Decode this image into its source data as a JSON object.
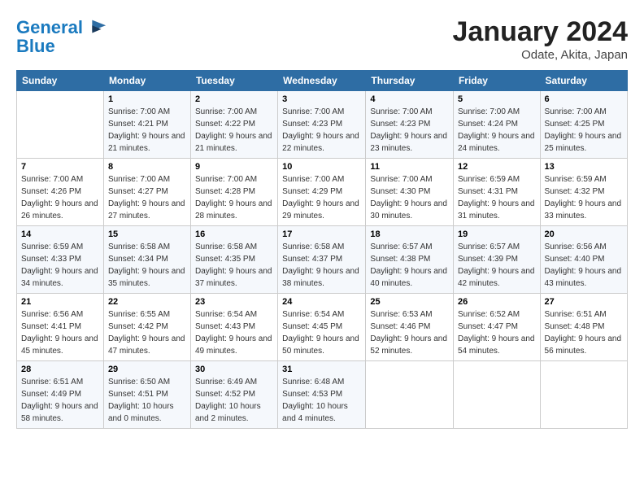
{
  "header": {
    "logo_line1": "General",
    "logo_line2": "Blue",
    "month_title": "January 2024",
    "location": "Odate, Akita, Japan"
  },
  "weekdays": [
    "Sunday",
    "Monday",
    "Tuesday",
    "Wednesday",
    "Thursday",
    "Friday",
    "Saturday"
  ],
  "weeks": [
    [
      {
        "day": "",
        "sunrise": "",
        "sunset": "",
        "daylight": ""
      },
      {
        "day": "1",
        "sunrise": "Sunrise: 7:00 AM",
        "sunset": "Sunset: 4:21 PM",
        "daylight": "Daylight: 9 hours and 21 minutes."
      },
      {
        "day": "2",
        "sunrise": "Sunrise: 7:00 AM",
        "sunset": "Sunset: 4:22 PM",
        "daylight": "Daylight: 9 hours and 21 minutes."
      },
      {
        "day": "3",
        "sunrise": "Sunrise: 7:00 AM",
        "sunset": "Sunset: 4:23 PM",
        "daylight": "Daylight: 9 hours and 22 minutes."
      },
      {
        "day": "4",
        "sunrise": "Sunrise: 7:00 AM",
        "sunset": "Sunset: 4:23 PM",
        "daylight": "Daylight: 9 hours and 23 minutes."
      },
      {
        "day": "5",
        "sunrise": "Sunrise: 7:00 AM",
        "sunset": "Sunset: 4:24 PM",
        "daylight": "Daylight: 9 hours and 24 minutes."
      },
      {
        "day": "6",
        "sunrise": "Sunrise: 7:00 AM",
        "sunset": "Sunset: 4:25 PM",
        "daylight": "Daylight: 9 hours and 25 minutes."
      }
    ],
    [
      {
        "day": "7",
        "sunrise": "Sunrise: 7:00 AM",
        "sunset": "Sunset: 4:26 PM",
        "daylight": "Daylight: 9 hours and 26 minutes."
      },
      {
        "day": "8",
        "sunrise": "Sunrise: 7:00 AM",
        "sunset": "Sunset: 4:27 PM",
        "daylight": "Daylight: 9 hours and 27 minutes."
      },
      {
        "day": "9",
        "sunrise": "Sunrise: 7:00 AM",
        "sunset": "Sunset: 4:28 PM",
        "daylight": "Daylight: 9 hours and 28 minutes."
      },
      {
        "day": "10",
        "sunrise": "Sunrise: 7:00 AM",
        "sunset": "Sunset: 4:29 PM",
        "daylight": "Daylight: 9 hours and 29 minutes."
      },
      {
        "day": "11",
        "sunrise": "Sunrise: 7:00 AM",
        "sunset": "Sunset: 4:30 PM",
        "daylight": "Daylight: 9 hours and 30 minutes."
      },
      {
        "day": "12",
        "sunrise": "Sunrise: 6:59 AM",
        "sunset": "Sunset: 4:31 PM",
        "daylight": "Daylight: 9 hours and 31 minutes."
      },
      {
        "day": "13",
        "sunrise": "Sunrise: 6:59 AM",
        "sunset": "Sunset: 4:32 PM",
        "daylight": "Daylight: 9 hours and 33 minutes."
      }
    ],
    [
      {
        "day": "14",
        "sunrise": "Sunrise: 6:59 AM",
        "sunset": "Sunset: 4:33 PM",
        "daylight": "Daylight: 9 hours and 34 minutes."
      },
      {
        "day": "15",
        "sunrise": "Sunrise: 6:58 AM",
        "sunset": "Sunset: 4:34 PM",
        "daylight": "Daylight: 9 hours and 35 minutes."
      },
      {
        "day": "16",
        "sunrise": "Sunrise: 6:58 AM",
        "sunset": "Sunset: 4:35 PM",
        "daylight": "Daylight: 9 hours and 37 minutes."
      },
      {
        "day": "17",
        "sunrise": "Sunrise: 6:58 AM",
        "sunset": "Sunset: 4:37 PM",
        "daylight": "Daylight: 9 hours and 38 minutes."
      },
      {
        "day": "18",
        "sunrise": "Sunrise: 6:57 AM",
        "sunset": "Sunset: 4:38 PM",
        "daylight": "Daylight: 9 hours and 40 minutes."
      },
      {
        "day": "19",
        "sunrise": "Sunrise: 6:57 AM",
        "sunset": "Sunset: 4:39 PM",
        "daylight": "Daylight: 9 hours and 42 minutes."
      },
      {
        "day": "20",
        "sunrise": "Sunrise: 6:56 AM",
        "sunset": "Sunset: 4:40 PM",
        "daylight": "Daylight: 9 hours and 43 minutes."
      }
    ],
    [
      {
        "day": "21",
        "sunrise": "Sunrise: 6:56 AM",
        "sunset": "Sunset: 4:41 PM",
        "daylight": "Daylight: 9 hours and 45 minutes."
      },
      {
        "day": "22",
        "sunrise": "Sunrise: 6:55 AM",
        "sunset": "Sunset: 4:42 PM",
        "daylight": "Daylight: 9 hours and 47 minutes."
      },
      {
        "day": "23",
        "sunrise": "Sunrise: 6:54 AM",
        "sunset": "Sunset: 4:43 PM",
        "daylight": "Daylight: 9 hours and 49 minutes."
      },
      {
        "day": "24",
        "sunrise": "Sunrise: 6:54 AM",
        "sunset": "Sunset: 4:45 PM",
        "daylight": "Daylight: 9 hours and 50 minutes."
      },
      {
        "day": "25",
        "sunrise": "Sunrise: 6:53 AM",
        "sunset": "Sunset: 4:46 PM",
        "daylight": "Daylight: 9 hours and 52 minutes."
      },
      {
        "day": "26",
        "sunrise": "Sunrise: 6:52 AM",
        "sunset": "Sunset: 4:47 PM",
        "daylight": "Daylight: 9 hours and 54 minutes."
      },
      {
        "day": "27",
        "sunrise": "Sunrise: 6:51 AM",
        "sunset": "Sunset: 4:48 PM",
        "daylight": "Daylight: 9 hours and 56 minutes."
      }
    ],
    [
      {
        "day": "28",
        "sunrise": "Sunrise: 6:51 AM",
        "sunset": "Sunset: 4:49 PM",
        "daylight": "Daylight: 9 hours and 58 minutes."
      },
      {
        "day": "29",
        "sunrise": "Sunrise: 6:50 AM",
        "sunset": "Sunset: 4:51 PM",
        "daylight": "Daylight: 10 hours and 0 minutes."
      },
      {
        "day": "30",
        "sunrise": "Sunrise: 6:49 AM",
        "sunset": "Sunset: 4:52 PM",
        "daylight": "Daylight: 10 hours and 2 minutes."
      },
      {
        "day": "31",
        "sunrise": "Sunrise: 6:48 AM",
        "sunset": "Sunset: 4:53 PM",
        "daylight": "Daylight: 10 hours and 4 minutes."
      },
      {
        "day": "",
        "sunrise": "",
        "sunset": "",
        "daylight": ""
      },
      {
        "day": "",
        "sunrise": "",
        "sunset": "",
        "daylight": ""
      },
      {
        "day": "",
        "sunrise": "",
        "sunset": "",
        "daylight": ""
      }
    ]
  ]
}
